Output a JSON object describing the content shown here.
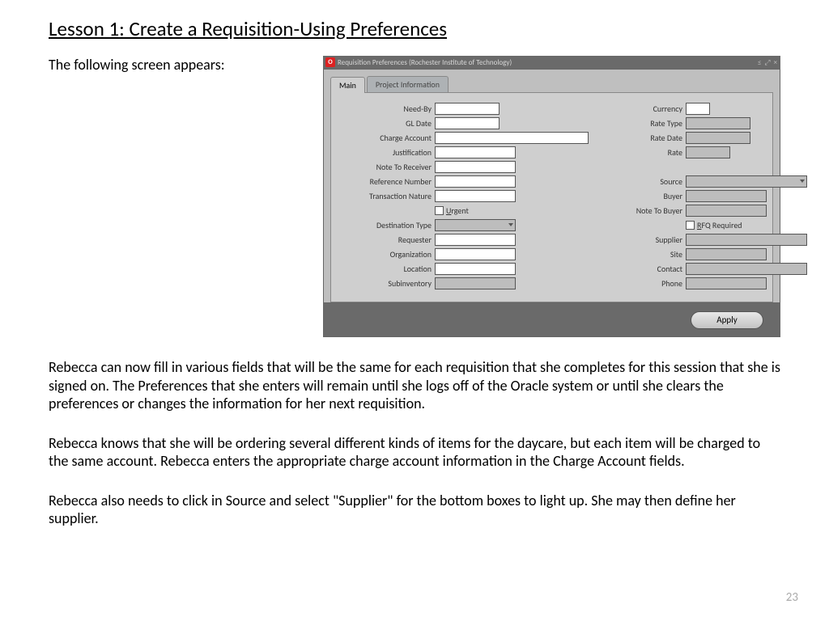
{
  "title": "Lesson 1:  Create a Requisition-Using Preferences",
  "intro": "The following screen appears:",
  "window": {
    "title": "Requisition Preferences (Rochester Institute of Technology)",
    "tabs": {
      "main": "Main",
      "project": "Project Information"
    },
    "left": {
      "needby": "Need-By",
      "gldate": "GL Date",
      "chargeacct": "Charge Account",
      "justification": "Justification",
      "notetorecv": "Note To Receiver",
      "refnum": "Reference Number",
      "transnat": "Transaction Nature",
      "urgent_u": "U",
      "urgent_rest": "rgent",
      "desttype": "Destination Type",
      "requester": "Requester",
      "org": "Organization",
      "location": "Location",
      "subinv": "Subinventory"
    },
    "right": {
      "currency": "Currency",
      "ratetype": "Rate Type",
      "ratedate": "Rate Date",
      "rate": "Rate",
      "source": "Source",
      "buyer": "Buyer",
      "notetobuyer": "Note To Buyer",
      "rfq_r": "R",
      "rfq_rest": "FQ Required",
      "supplier": "Supplier",
      "site": "Site",
      "contact": "Contact",
      "phone": "Phone"
    },
    "apply": "Apply"
  },
  "p1": "Rebecca can now fill in various fields that will be the same for each requisition that she completes for this session that she is signed on.  The Preferences that she enters will remain until she logs off of the Oracle system or until she clears the preferences or changes the information for her next requisition.",
  "p2": "Rebecca knows that she will be ordering several different kinds of items for the daycare, but each item will be charged to the same account.  Rebecca enters the appropriate charge account information in the Charge Account fields.",
  "p3": "Rebecca also needs to click in Source and select \"Supplier\" for the bottom boxes to light up.  She may then define her supplier.",
  "pagenum": "23"
}
